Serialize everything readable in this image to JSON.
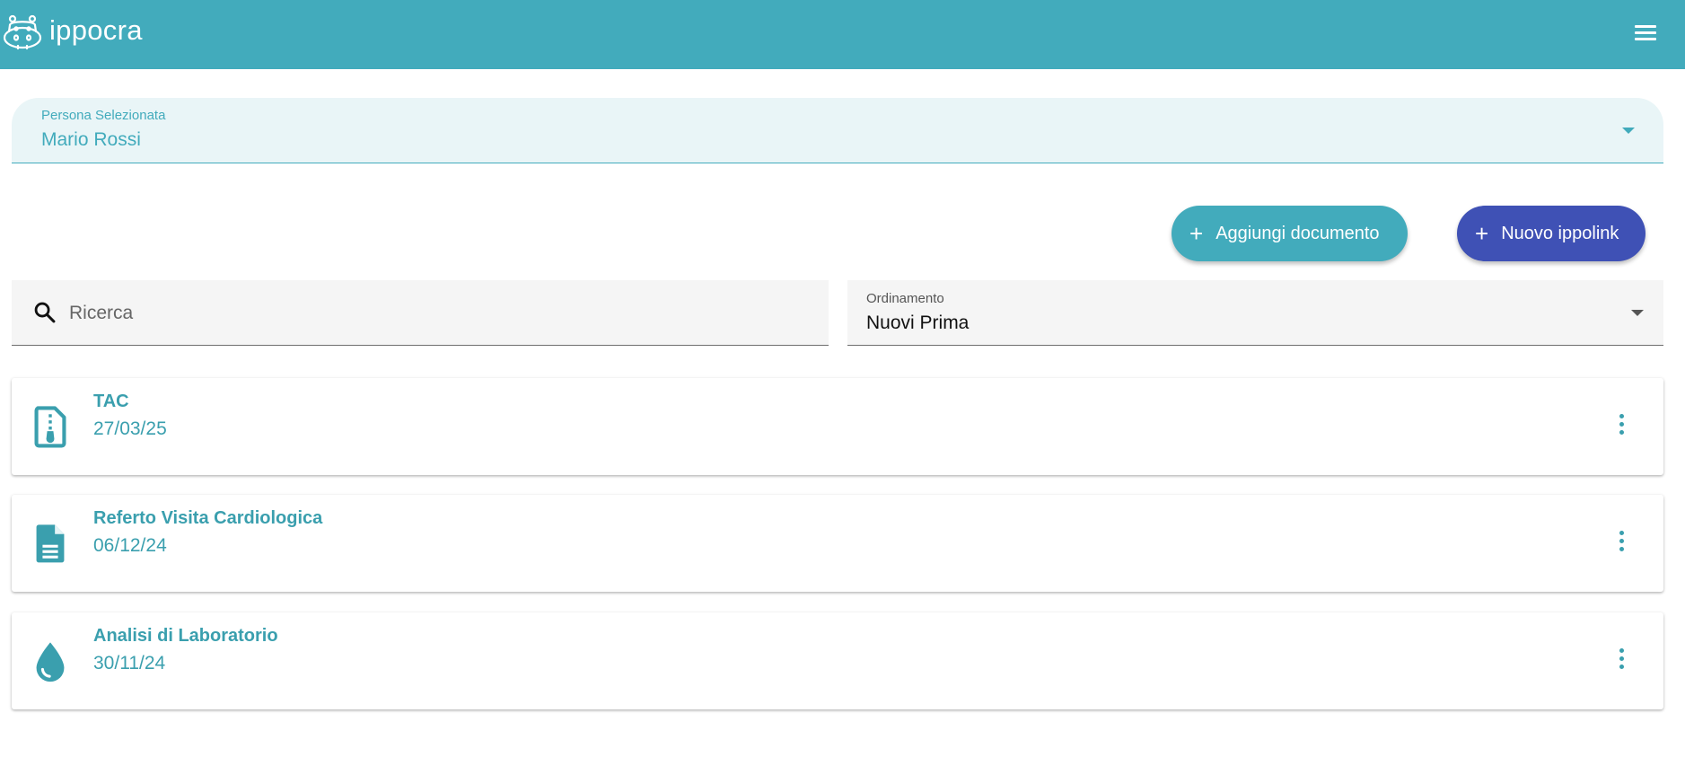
{
  "app": {
    "brand": "ippocra"
  },
  "person": {
    "label": "Persona Selezionata",
    "value": "Mario Rossi"
  },
  "actions": {
    "add_document": "Aggiungi documento",
    "new_ippolink": "Nuovo ippolink"
  },
  "search": {
    "placeholder": "Ricerca"
  },
  "sort": {
    "label": "Ordinamento",
    "value": "Nuovi Prima"
  },
  "documents": [
    {
      "title": "TAC",
      "date": "27/03/25",
      "icon": "zip-file-icon"
    },
    {
      "title": "Referto Visita Cardiologica",
      "date": "06/12/24",
      "icon": "document-icon"
    },
    {
      "title": "Analisi di Laboratorio",
      "date": "30/11/24",
      "icon": "drop-icon"
    }
  ],
  "colors": {
    "primary": "#42abbc",
    "secondary": "#3f51b5",
    "text_accent": "#3a9fae"
  }
}
